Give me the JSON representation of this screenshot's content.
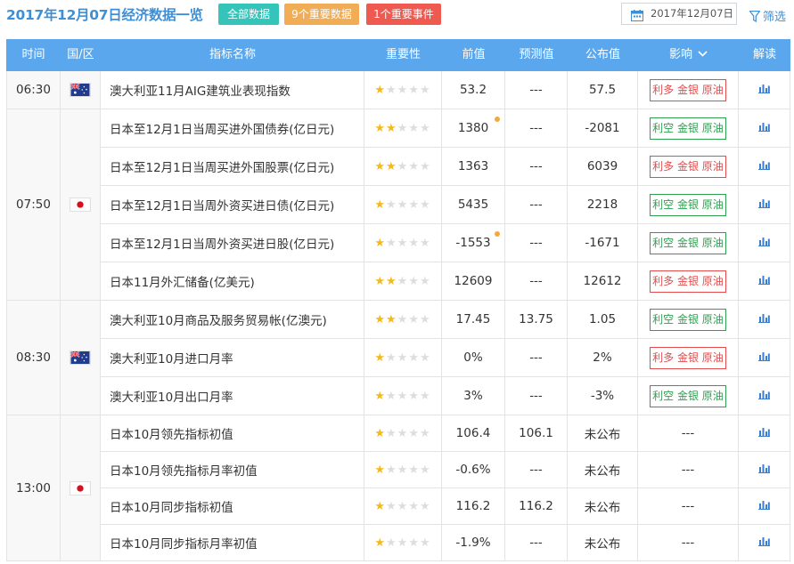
{
  "header": {
    "title": "2017年12月07日经济数据一览",
    "filters": [
      {
        "label": "全部数据",
        "color": "#35c4ba"
      },
      {
        "label": "9个重要数据",
        "color": "#f1ad55"
      },
      {
        "label": "1个重要事件",
        "color": "#ee5a4f"
      }
    ],
    "date": "2017年12月07日",
    "filter_link": "筛选"
  },
  "columns": [
    "时间",
    "国/区",
    "指标名称",
    "重要性",
    "前值",
    "预测值",
    "公布值",
    "影响",
    "解读"
  ],
  "colors": {
    "header_bg": "#5aa7ee",
    "title": "#3f8fd6",
    "bullish": "#e24c4c",
    "bearish": "#2fa050",
    "star": "#f3b91e"
  },
  "groups": [
    {
      "time": "06:30",
      "country": "australia-flag",
      "rows": [
        {
          "name": "澳大利亚11月AIG建筑业表现指数",
          "stars": 1,
          "prev": "53.2",
          "forecast": "---",
          "actual": "57.5",
          "impact": "利多 金银 原油",
          "impact_type": "bullish",
          "mark": false
        }
      ]
    },
    {
      "time": "07:50",
      "country": "japan-flag",
      "rows": [
        {
          "name": "日本至12月1日当周买进外国债券(亿日元)",
          "stars": 2,
          "prev": "1380",
          "forecast": "---",
          "actual": "-2081",
          "impact": "利空 金银 原油",
          "impact_type": "bearish",
          "mark": true
        },
        {
          "name": "日本至12月1日当周买进外国股票(亿日元)",
          "stars": 2,
          "prev": "1363",
          "forecast": "---",
          "actual": "6039",
          "impact": "利多 金银 原油",
          "impact_type": "bullish",
          "mark": false
        },
        {
          "name": "日本至12月1日当周外资买进日债(亿日元)",
          "stars": 1,
          "prev": "5435",
          "forecast": "---",
          "actual": "2218",
          "impact": "利空 金银 原油",
          "impact_type": "bearish",
          "mark": false
        },
        {
          "name": "日本至12月1日当周外资买进日股(亿日元)",
          "stars": 1,
          "prev": "-1553",
          "forecast": "---",
          "actual": "-1671",
          "impact": "利空 金银 原油",
          "impact_type": "bearish",
          "mark": true
        },
        {
          "name": "日本11月外汇储备(亿美元)",
          "stars": 2,
          "prev": "12609",
          "forecast": "---",
          "actual": "12612",
          "impact": "利多 金银 原油",
          "impact_type": "bullish",
          "mark": false
        }
      ]
    },
    {
      "time": "08:30",
      "country": "australia-flag",
      "rows": [
        {
          "name": "澳大利亚10月商品及服务贸易帐(亿澳元)",
          "stars": 2,
          "prev": "17.45",
          "forecast": "13.75",
          "actual": "1.05",
          "impact": "利空 金银 原油",
          "impact_type": "bearish",
          "mark": false
        },
        {
          "name": "澳大利亚10月进口月率",
          "stars": 1,
          "prev": "0%",
          "forecast": "---",
          "actual": "2%",
          "impact": "利多 金银 原油",
          "impact_type": "bullish",
          "mark": false
        },
        {
          "name": "澳大利亚10月出口月率",
          "stars": 1,
          "prev": "3%",
          "forecast": "---",
          "actual": "-3%",
          "impact": "利空 金银 原油",
          "impact_type": "bearish",
          "mark": false
        }
      ]
    },
    {
      "time": "13:00",
      "country": "japan-flag",
      "rows": [
        {
          "name": "日本10月领先指标初值",
          "stars": 1,
          "prev": "106.4",
          "forecast": "106.1",
          "actual": "未公布",
          "impact": "---",
          "impact_type": "none",
          "mark": false
        },
        {
          "name": "日本10月领先指标月率初值",
          "stars": 1,
          "prev": "-0.6%",
          "forecast": "---",
          "actual": "未公布",
          "impact": "---",
          "impact_type": "none",
          "mark": false
        },
        {
          "name": "日本10月同步指标初值",
          "stars": 1,
          "prev": "116.2",
          "forecast": "116.2",
          "actual": "未公布",
          "impact": "---",
          "impact_type": "none",
          "mark": false
        },
        {
          "name": "日本10月同步指标月率初值",
          "stars": 1,
          "prev": "-1.9%",
          "forecast": "---",
          "actual": "未公布",
          "impact": "---",
          "impact_type": "none",
          "mark": false
        }
      ]
    }
  ]
}
